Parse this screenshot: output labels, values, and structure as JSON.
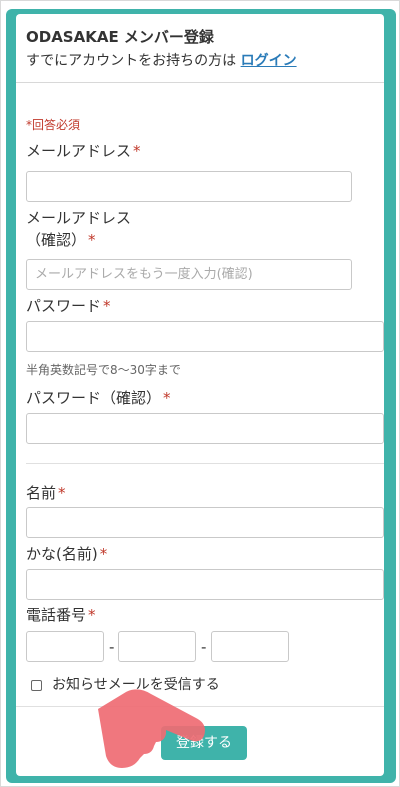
{
  "header": {
    "title": "ODASAKAE メンバー登録",
    "subtitle_prefix": "すでにアカウントをお持ちの方は",
    "login_link": "ログイン"
  },
  "form": {
    "required_note": "*回答必須",
    "required_mark": "*",
    "email_label": "メールアドレス",
    "email_confirm_label_line1": "メールアドレス",
    "email_confirm_label_line2": "（確認）",
    "email_confirm_placeholder": "メールアドレスをもう一度入力(確認)",
    "password_label": "パスワード",
    "password_hint": "半角英数記号で8〜30字まで",
    "password_confirm_label": "パスワード（確認）",
    "name_label": "名前",
    "kana_label": "かな(名前)",
    "phone_label": "電話番号",
    "phone_separator": "-",
    "newsletter_label": "お知らせメールを受信する",
    "submit_label": "登録する"
  },
  "colors": {
    "accent": "#3fb3aa",
    "required": "#c0392b",
    "link": "#2a7bb8"
  }
}
